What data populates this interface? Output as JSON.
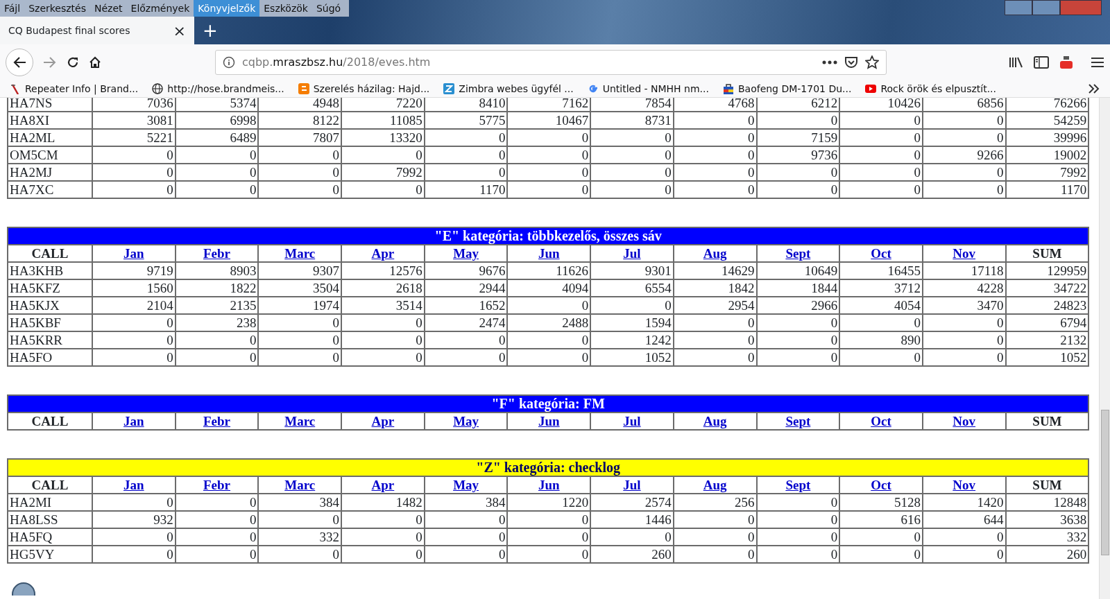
{
  "menu": [
    {
      "label": "Fájl",
      "selected": false
    },
    {
      "label": "Szerkesztés",
      "selected": false
    },
    {
      "label": "Nézet",
      "selected": false
    },
    {
      "label": "Előzmények",
      "selected": false
    },
    {
      "label": "Könyvjelzők",
      "selected": true
    },
    {
      "label": "Eszközök",
      "selected": false
    },
    {
      "label": "Súgó",
      "selected": false
    }
  ],
  "tab": {
    "title": "CQ Budapest final scores",
    "close": "×",
    "new_tab": "+"
  },
  "address": {
    "prefix": "cqbp.",
    "domain": "mraszbsz.hu",
    "path": "/2018/eves.htm"
  },
  "bookmarks": [
    {
      "label": "Repeater Info | Brand...",
      "kind": "antenna"
    },
    {
      "label": "http://hose.brandmeis...",
      "kind": "globe"
    },
    {
      "label": "Szerelés házilag: Hajd...",
      "kind": "blogger"
    },
    {
      "label": "Zimbra webes ügyfél ...",
      "kind": "zimbra"
    },
    {
      "label": "Untitled - NMHH  nm...",
      "kind": "google"
    },
    {
      "label": "Baofeng DM-1701 Du...",
      "kind": "bag"
    },
    {
      "label": "Rock örök és elpusztít...",
      "kind": "youtube"
    }
  ],
  "sections": [
    {
      "rows": [
        [
          "HA7NS",
          "7036",
          "5374",
          "4948",
          "7220",
          "8410",
          "7162",
          "7854",
          "4768",
          "6212",
          "10426",
          "6856",
          "76266"
        ],
        [
          "HA8XI",
          "3081",
          "6998",
          "8122",
          "11085",
          "5775",
          "10467",
          "8731",
          "0",
          "0",
          "0",
          "0",
          "54259"
        ],
        [
          "HA2ML",
          "5221",
          "6489",
          "7807",
          "13320",
          "0",
          "0",
          "0",
          "0",
          "7159",
          "0",
          "0",
          "39996"
        ],
        [
          "OM5CM",
          "0",
          "0",
          "0",
          "0",
          "0",
          "0",
          "0",
          "0",
          "9736",
          "0",
          "9266",
          "19002"
        ],
        [
          "HA2MJ",
          "0",
          "0",
          "0",
          "7992",
          "0",
          "0",
          "0",
          "0",
          "0",
          "0",
          "0",
          "7992"
        ],
        [
          "HA7XC",
          "0",
          "0",
          "0",
          "0",
          "1170",
          "0",
          "0",
          "0",
          "0",
          "0",
          "0",
          "1170"
        ]
      ]
    },
    {
      "title": "\"E\" kategória: többkezelős, összes sáv",
      "color": "#0000ff",
      "header": [
        {
          "text": "CALL",
          "link": false
        },
        {
          "text": "Jan",
          "link": true
        },
        {
          "text": "Febr",
          "link": true
        },
        {
          "text": "Marc",
          "link": true
        },
        {
          "text": "Apr",
          "link": true
        },
        {
          "text": "May",
          "link": true
        },
        {
          "text": "Jun",
          "link": true
        },
        {
          "text": "Jul",
          "link": true
        },
        {
          "text": "Aug",
          "link": true
        },
        {
          "text": "Sept",
          "link": true
        },
        {
          "text": "Oct",
          "link": true
        },
        {
          "text": "Nov",
          "link": true
        },
        {
          "text": "SUM",
          "link": false
        }
      ],
      "rows": [
        [
          "HA3KHB",
          "9719",
          "8903",
          "9307",
          "12576",
          "9676",
          "11626",
          "9301",
          "14629",
          "10649",
          "16455",
          "17118",
          "129959"
        ],
        [
          "HA5KFZ",
          "1560",
          "1822",
          "3504",
          "2618",
          "2944",
          "4094",
          "6554",
          "1842",
          "1844",
          "3712",
          "4228",
          "34722"
        ],
        [
          "HA5KJX",
          "2104",
          "2135",
          "1974",
          "3514",
          "1652",
          "0",
          "0",
          "2954",
          "2966",
          "4054",
          "3470",
          "24823"
        ],
        [
          "HA5KBF",
          "0",
          "238",
          "0",
          "0",
          "2474",
          "2488",
          "1594",
          "0",
          "0",
          "0",
          "0",
          "6794"
        ],
        [
          "HA5KRR",
          "0",
          "0",
          "0",
          "0",
          "0",
          "0",
          "1242",
          "0",
          "0",
          "890",
          "0",
          "2132"
        ],
        [
          "HA5FO",
          "0",
          "0",
          "0",
          "0",
          "0",
          "0",
          "1052",
          "0",
          "0",
          "0",
          "0",
          "1052"
        ]
      ]
    },
    {
      "title": "\"F\" kategória: FM",
      "color": "#0000ff",
      "header": [
        {
          "text": "CALL",
          "link": false
        },
        {
          "text": "Jan",
          "link": true
        },
        {
          "text": "Febr",
          "link": true
        },
        {
          "text": "Marc",
          "link": true
        },
        {
          "text": "Apr",
          "link": true
        },
        {
          "text": "May",
          "link": true
        },
        {
          "text": "Jun",
          "link": true
        },
        {
          "text": "Jul",
          "link": true
        },
        {
          "text": "Aug",
          "link": true
        },
        {
          "text": "Sept",
          "link": true
        },
        {
          "text": "Oct",
          "link": true
        },
        {
          "text": "Nov",
          "link": true
        },
        {
          "text": "SUM",
          "link": false
        }
      ]
    },
    {
      "title": "\"Z\" kategória: checklog",
      "color": "#ffff00",
      "header": [
        {
          "text": "CALL",
          "link": false
        },
        {
          "text": "Jan",
          "link": true
        },
        {
          "text": "Febr",
          "link": true
        },
        {
          "text": "Marc",
          "link": true
        },
        {
          "text": "Apr",
          "link": true
        },
        {
          "text": "May",
          "link": true
        },
        {
          "text": "Jun",
          "link": true
        },
        {
          "text": "Jul",
          "link": true
        },
        {
          "text": "Aug",
          "link": true
        },
        {
          "text": "Sept",
          "link": true
        },
        {
          "text": "Oct",
          "link": true
        },
        {
          "text": "Nov",
          "link": true
        },
        {
          "text": "SUM",
          "link": false
        }
      ],
      "rows": [
        [
          "HA2MI",
          "0",
          "0",
          "384",
          "1482",
          "384",
          "1220",
          "2574",
          "256",
          "0",
          "5128",
          "1420",
          "12848"
        ],
        [
          "HA8LSS",
          "932",
          "0",
          "0",
          "0",
          "0",
          "0",
          "1446",
          "0",
          "0",
          "616",
          "644",
          "3638"
        ],
        [
          "HA5FQ",
          "0",
          "0",
          "332",
          "0",
          "0",
          "0",
          "0",
          "0",
          "0",
          "0",
          "0",
          "332"
        ],
        [
          "HG5VY",
          "0",
          "0",
          "0",
          "0",
          "0",
          "0",
          "260",
          "0",
          "0",
          "0",
          "0",
          "260"
        ]
      ]
    }
  ]
}
